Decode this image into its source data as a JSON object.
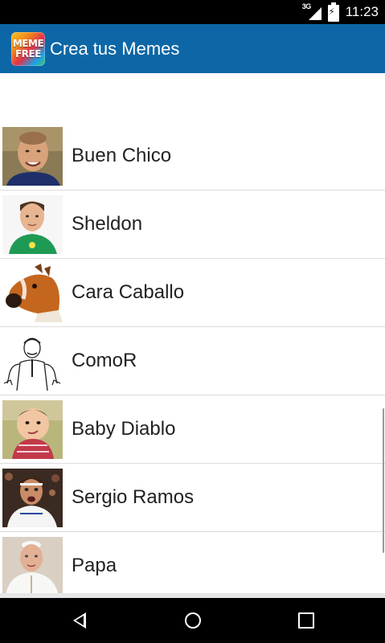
{
  "status_bar": {
    "network_label": "3G",
    "time": "11:23",
    "icons": [
      "signal-icon",
      "battery-charging-icon"
    ]
  },
  "app_bar": {
    "logo_line1": "MEME",
    "logo_line2": "FREE",
    "title": "Crea tus Memes",
    "background_color": "#0d67a6"
  },
  "meme_list": {
    "items": [
      {
        "label": "Buen Chico",
        "thumbnail": "good-guy-photo"
      },
      {
        "label": "Sheldon",
        "thumbnail": "sheldon-photo"
      },
      {
        "label": "Cara Caballo",
        "thumbnail": "horse-mask-photo"
      },
      {
        "label": "ComoR",
        "thumbnail": "comor-drawing"
      },
      {
        "label": "Baby Diablo",
        "thumbnail": "evil-baby-photo"
      },
      {
        "label": "Sergio Ramos",
        "thumbnail": "sergio-ramos-photo"
      },
      {
        "label": "Papa",
        "thumbnail": "pope-photo"
      }
    ]
  },
  "nav_bar": {
    "icons": [
      "back-icon",
      "home-icon",
      "recent-apps-icon"
    ]
  }
}
